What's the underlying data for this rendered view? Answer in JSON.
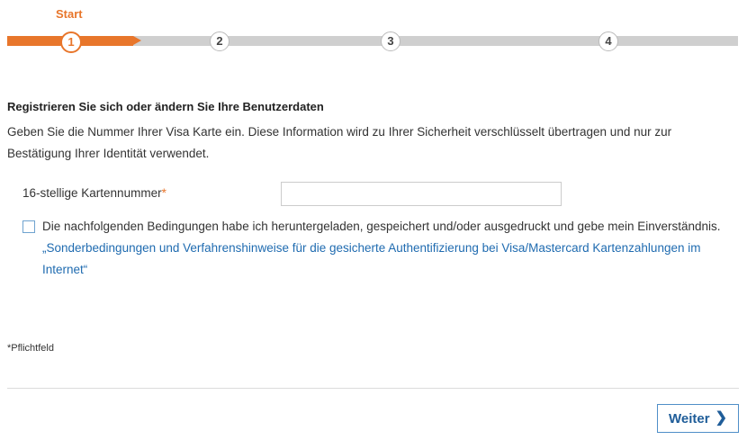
{
  "stepper": {
    "current_label": "Start",
    "steps": [
      "1",
      "2",
      "3",
      "4"
    ],
    "active_color": "#e8762b",
    "inactive_color": "#cfcfcf"
  },
  "form": {
    "heading": "Registrieren Sie sich oder ändern Sie Ihre Benutzerdaten",
    "intro": "Geben Sie die Nummer Ihrer Visa Karte ein. Diese Information wird zu Ihrer Sicherheit verschlüsselt übertragen und nur zur Bestätigung Ihrer Identität verwendet.",
    "card_number_label": "16-stellige Kartennummer",
    "required_marker": "*",
    "card_number_value": "",
    "terms_text": "Die nachfolgenden Bedingungen habe ich heruntergeladen, gespeichert und/oder ausgedruckt und gebe mein Einverständnis.",
    "terms_link": "„Sonderbedingungen und Verfahrenshinweise für die gesicherte Authentifizierung bei Visa/Mastercard Kartenzahlungen im Internet“",
    "terms_checked": false,
    "footnote": "*Pflichtfeld"
  },
  "footer": {
    "next_label": "Weiter",
    "next_icon": "chevron-right-icon"
  }
}
